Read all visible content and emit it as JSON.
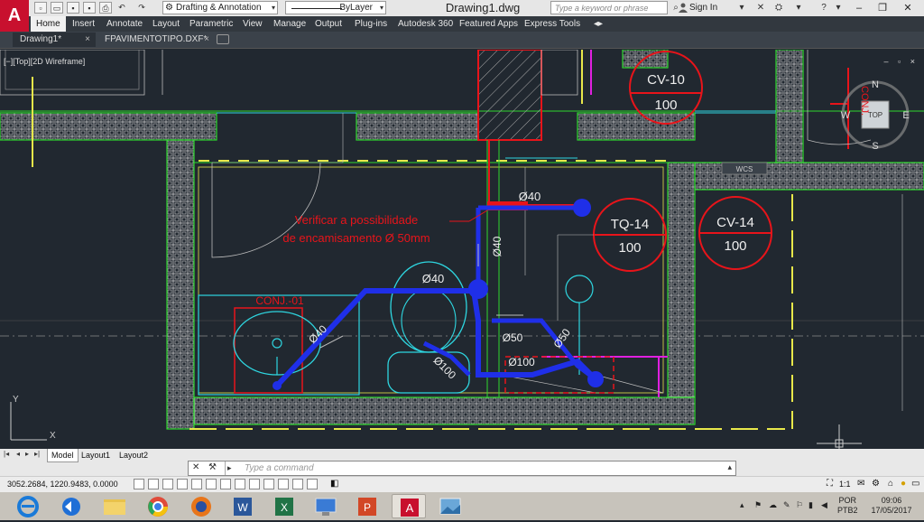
{
  "title_bar": {
    "app_logo": "A",
    "workspace": "Drafting & Annotation",
    "layer": "ByLayer",
    "document_title": "Drawing1.dwg",
    "search_placeholder": "Type a keyword or phrase",
    "sign_in": "Sign In"
  },
  "ribbon_tabs": [
    "Home",
    "Insert",
    "Annotate",
    "Layout",
    "Parametric",
    "View",
    "Manage",
    "Output",
    "Plug-ins",
    "Autodesk 360",
    "Featured Apps",
    "Express Tools"
  ],
  "doc_tabs": [
    {
      "label": "Drawing1*",
      "close": "×"
    },
    {
      "label": "FPAVIMENTOTIPO.DXF*",
      "close": "×"
    }
  ],
  "viewport": {
    "view_label": "[−][Top][2D Wireframe]",
    "window_controls": "– ▫ ×"
  },
  "viewcube": {
    "top": "TOP",
    "n": "N",
    "s": "S",
    "e": "E",
    "w": "W",
    "wcs": "WCS"
  },
  "drawing_text": {
    "note_line1": "Verificar a possibilidade",
    "note_line2": "de encamisamento Ø 50mm",
    "conj_label": "CONJ.-01",
    "cv10_top": "CV-10",
    "cv10_bottom": "100",
    "tq14_top": "TQ-14",
    "tq14_bottom": "100",
    "cv14_top": "CV-14",
    "cv14_bottom": "100",
    "d40_a": "Ø40",
    "d40_b": "Ø40",
    "d40_c": "Ø40",
    "d40_d": "Ø40",
    "d50_a": "Ø50",
    "d50_b": "Ø50",
    "d100_a": "Ø100",
    "d100_b": "Ø100",
    "conj_vertical": "CONJ.",
    "ucs_x": "X",
    "ucs_y": "Y"
  },
  "layout_tabs": [
    "Model",
    "Layout1",
    "Layout2"
  ],
  "command_line": {
    "placeholder": "Type a command"
  },
  "status_bar": {
    "coordinates": "3052.2684, 1220.9483, 0.0000",
    "scale": "1:1"
  },
  "taskbar": {
    "language": "POR",
    "language_sub": "PTB2",
    "time": "09:06",
    "date": "17/05/2017"
  },
  "colors": {
    "red_pipe": "#e8141a",
    "blue_pipe": "#1f2fe8",
    "green": "#2ed82e",
    "cyan": "#2ed6e0",
    "magenta": "#e020e0",
    "yellow": "#e8e84a",
    "background": "#212830"
  }
}
